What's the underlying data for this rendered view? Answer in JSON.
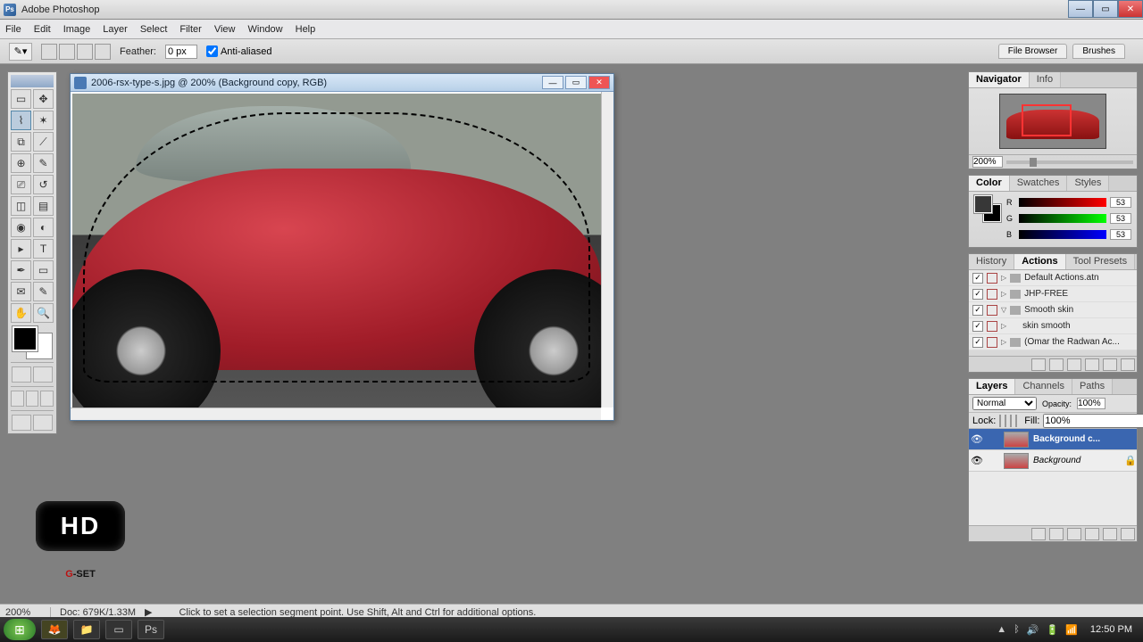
{
  "app": {
    "title": "Adobe Photoshop"
  },
  "win_buttons": {
    "min": "—",
    "max": "▭",
    "close": "✕"
  },
  "menu": [
    "File",
    "Edit",
    "Image",
    "Layer",
    "Select",
    "Filter",
    "View",
    "Window",
    "Help"
  ],
  "options": {
    "feather_label": "Feather:",
    "feather_value": "0 px",
    "antialias": "Anti-aliased",
    "tabs": [
      "File Browser",
      "Brushes"
    ]
  },
  "document": {
    "title": "2006-rsx-type-s.jpg @ 200% (Background copy, RGB)"
  },
  "navigator": {
    "tabs": [
      "Navigator",
      "Info"
    ],
    "zoom": "200%"
  },
  "color": {
    "tabs": [
      "Color",
      "Swatches",
      "Styles"
    ],
    "r": "53",
    "g": "53",
    "b": "53"
  },
  "actions": {
    "tabs": [
      "History",
      "Actions",
      "Tool Presets"
    ],
    "items": [
      {
        "name": "Default Actions.atn",
        "folder": true
      },
      {
        "name": "JHP-FREE",
        "folder": true
      },
      {
        "name": "Smooth skin",
        "folder": true,
        "open": true
      },
      {
        "name": "skin smooth",
        "folder": false,
        "indent": true
      },
      {
        "name": "(Omar the Radwan Ac...",
        "folder": true
      }
    ]
  },
  "layers": {
    "tabs": [
      "Layers",
      "Channels",
      "Paths"
    ],
    "blend": "Normal",
    "opacity_label": "Opacity:",
    "opacity": "100%",
    "lock_label": "Lock:",
    "fill_label": "Fill:",
    "fill": "100%",
    "items": [
      {
        "name": "Background c...",
        "selected": true
      },
      {
        "name": "Background",
        "locked": true,
        "italic": true
      }
    ]
  },
  "status": {
    "zoom": "200%",
    "doc": "Doc: 679K/1.33M",
    "hint": "Click to set a selection segment point.  Use Shift, Alt and Ctrl for additional options."
  },
  "taskbar": {
    "clock": "12:50 PM"
  },
  "logo": {
    "hd": "HD",
    "g": "G",
    "set": "-SET"
  }
}
